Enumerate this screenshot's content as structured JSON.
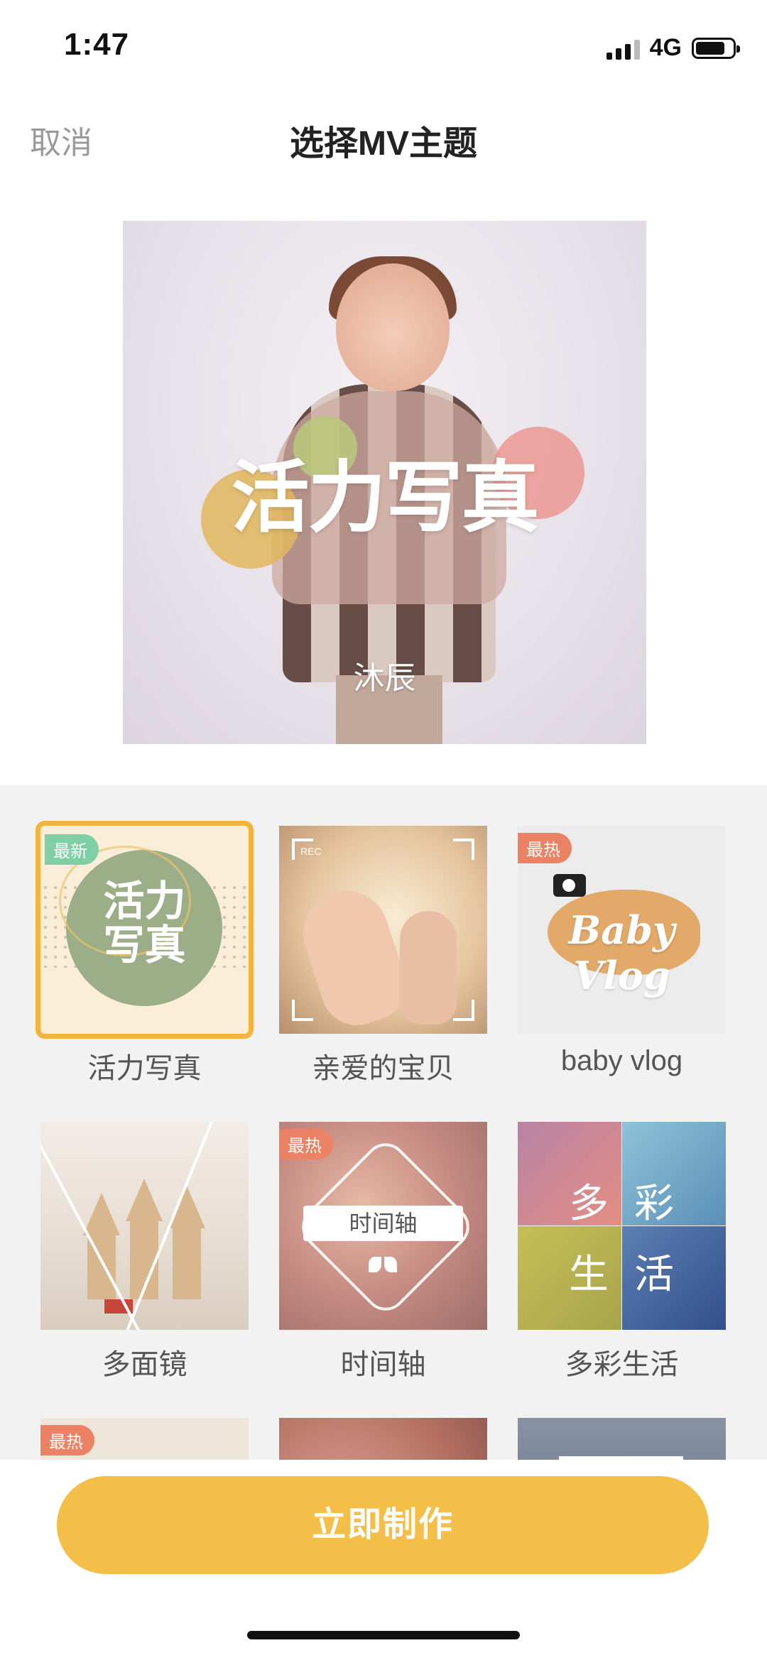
{
  "status_bar": {
    "time": "1:47",
    "network": "4G",
    "icons": [
      "signal-icon",
      "battery-icon"
    ]
  },
  "nav": {
    "cancel_label": "取消",
    "title": "选择MV主题"
  },
  "preview": {
    "theme_title": "活力写真",
    "name_caption": "沐辰"
  },
  "themes": [
    {
      "label": "活力写真",
      "badge": "最新",
      "art_text": "活力\n写真",
      "selected": true
    },
    {
      "label": "亲爱的宝贝",
      "badge": "",
      "art_text": "REC"
    },
    {
      "label": "baby vlog",
      "badge": "最热",
      "art_text": "Baby Vlog"
    },
    {
      "label": "多面镜",
      "badge": ""
    },
    {
      "label": "时间轴",
      "badge": "最热",
      "art_text": "时间轴"
    },
    {
      "label": "多彩生活",
      "badge": "",
      "art_chars": [
        "多",
        "彩",
        "生",
        "活"
      ]
    },
    {
      "label": "",
      "badge": "最热"
    },
    {
      "label": "",
      "badge": ""
    },
    {
      "label": "",
      "badge": ""
    }
  ],
  "action": {
    "make_label": "立即制作"
  },
  "colors": {
    "accent": "#f3bf48",
    "badge_new": "#7fcfa6",
    "badge_hot": "#ea8263",
    "panel_bg": "#f2f2f3"
  }
}
